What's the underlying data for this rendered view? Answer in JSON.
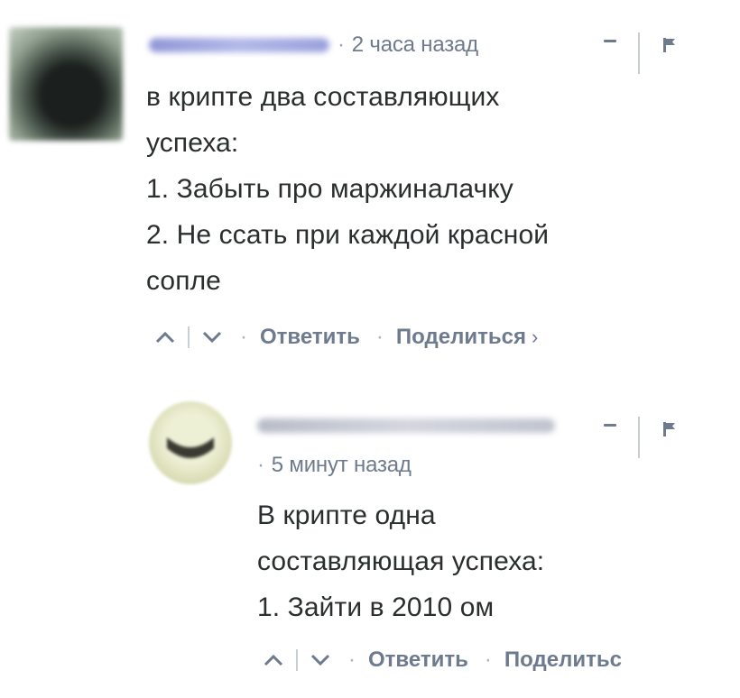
{
  "comment": {
    "time": "2 часа назад",
    "body_lines": [
      "в криптe два составляющих",
      "успеха:",
      "1. Забыть про маржиналачку",
      "2. Не ссать при каждой красной",
      "сопле"
    ],
    "actions": {
      "reply": "Ответить",
      "share": "Поделиться",
      "share_chevron": "›"
    }
  },
  "reply": {
    "time": "5 минут назад",
    "body_lines": [
      "В крипте одна",
      "составляющая успеха:",
      "1. Зайти в 2010 ом"
    ],
    "actions": {
      "reply": "Ответить",
      "share": "Поделитьс"
    }
  },
  "colors": {
    "meta_text": "#6e7a8d",
    "body_text": "#2a2e2e",
    "separator": "#c9ced6"
  }
}
